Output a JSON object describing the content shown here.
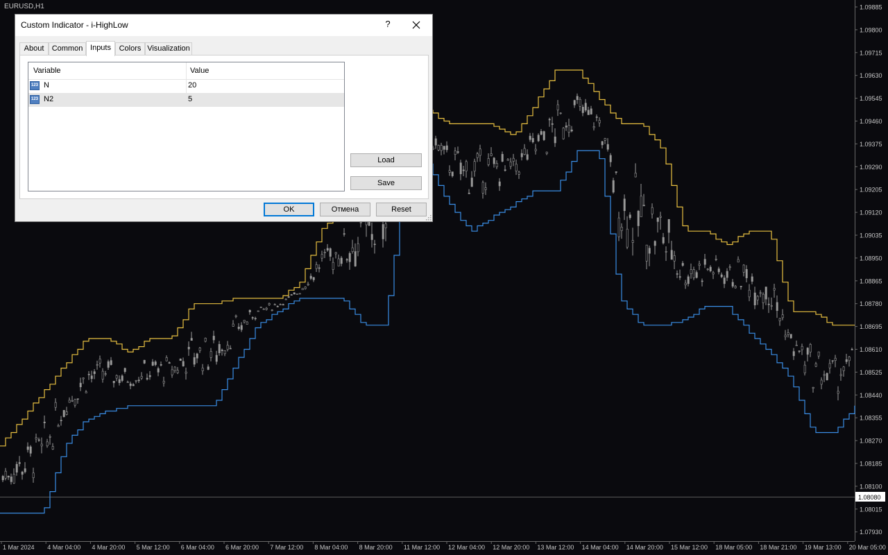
{
  "chart": {
    "symbol": "EURUSD,H1",
    "price_levels": [
      "1.09885",
      "1.09800",
      "1.09715",
      "1.09630",
      "1.09545",
      "1.09460",
      "1.09375",
      "1.09290",
      "1.09205",
      "1.09120",
      "1.09035",
      "1.08950",
      "1.08865",
      "1.08780",
      "1.08695",
      "1.08610",
      "1.08525",
      "1.08440",
      "1.08355",
      "1.08270",
      "1.08185",
      "1.08100",
      "1.08015",
      "1.07930"
    ],
    "current_price": "1.08080",
    "time_labels": [
      "1 Mar 2024",
      "4 Mar 04:00",
      "4 Mar 20:00",
      "5 Mar 12:00",
      "6 Mar 04:00",
      "6 Mar 20:00",
      "7 Mar 12:00",
      "8 Mar 04:00",
      "8 Mar 20:00",
      "11 Mar 12:00",
      "12 Mar 04:00",
      "12 Mar 20:00",
      "13 Mar 12:00",
      "14 Mar 04:00",
      "14 Mar 20:00",
      "15 Mar 12:00",
      "18 Mar 05:00",
      "18 Mar 21:00",
      "19 Mar 13:00",
      "20 Mar 05:00"
    ],
    "colors": {
      "background": "#0a0a0e",
      "high_line": "#e8c040",
      "low_line": "#3a8ee6",
      "candles": "#9a9a9a",
      "axis_text": "#c8c8c8"
    }
  },
  "chart_data": {
    "type": "line",
    "ylim": [
      1.0793,
      1.0989
    ],
    "series": [
      {
        "values": [
          1.0825,
          1.0835,
          1.0845,
          1.0855,
          1.0865,
          1.0865,
          1.086,
          1.0865,
          1.0865,
          1.0878,
          1.0878,
          1.088,
          1.088,
          1.088,
          1.0885,
          1.0905,
          1.0915,
          1.0932,
          1.0955,
          1.0955,
          1.095,
          1.0945,
          1.0945,
          1.0945,
          1.094,
          1.0952,
          1.0965,
          1.0965,
          1.0955,
          1.0945,
          1.0945,
          1.0935,
          1.0905,
          1.0905,
          1.09,
          1.0905,
          1.0905,
          1.0875,
          1.0875,
          1.087,
          1.087
        ]
      },
      {
        "values": [
          1.08,
          1.08,
          1.08,
          1.0825,
          1.0835,
          1.0838,
          1.084,
          1.084,
          1.084,
          1.084,
          1.084,
          1.0855,
          1.087,
          1.0875,
          1.088,
          1.088,
          1.088,
          1.087,
          1.087,
          1.093,
          1.093,
          1.0915,
          1.0905,
          1.091,
          1.0915,
          1.092,
          1.092,
          1.0935,
          1.0935,
          1.088,
          1.087,
          1.087,
          1.0872,
          1.0877,
          1.0877,
          1.0868,
          1.086,
          1.085,
          1.083,
          1.083,
          1.084
        ]
      }
    ]
  },
  "dialog": {
    "title": "Custom Indicator - i-HighLow",
    "help_label": "?",
    "tabs": [
      "About",
      "Common",
      "Inputs",
      "Colors",
      "Visualization"
    ],
    "active_tab": "Inputs",
    "grid": {
      "columns": [
        "Variable",
        "Value"
      ],
      "rows": [
        {
          "icon": "123",
          "variable": "N",
          "value": "20"
        },
        {
          "icon": "123",
          "variable": "N2",
          "value": "5"
        }
      ]
    },
    "buttons": {
      "load": "Load",
      "save": "Save",
      "ok": "OK",
      "cancel": "Отмена",
      "reset": "Reset"
    }
  }
}
